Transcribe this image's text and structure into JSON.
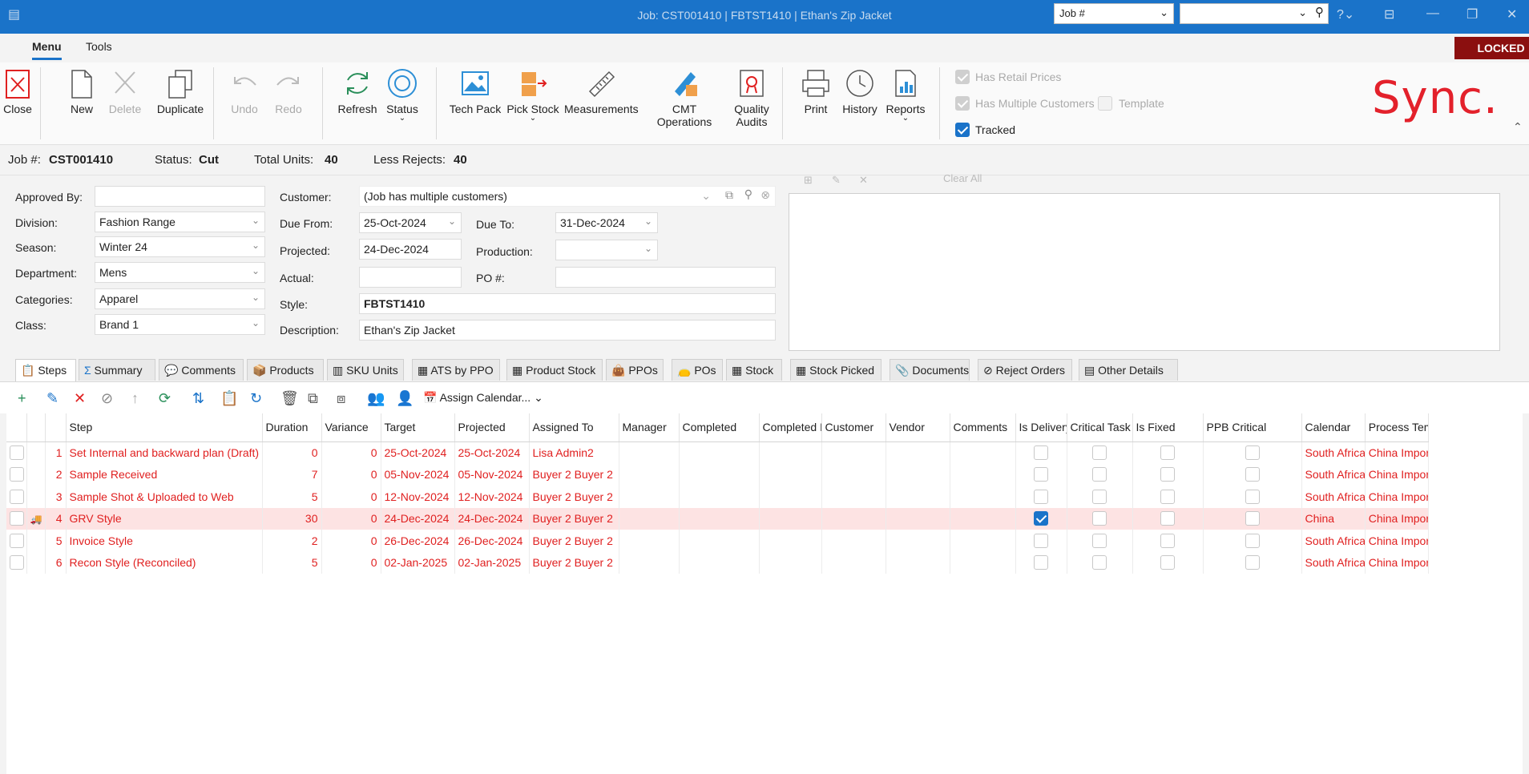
{
  "window": {
    "title": "Job: CST001410 | FBTST1410 | Ethan's Zip Jacket",
    "search_field_label": "Job #",
    "search_value": ""
  },
  "menu": {
    "tabs": [
      "Menu",
      "Tools"
    ],
    "locked_label": "LOCKED"
  },
  "ribbon": {
    "buttons": {
      "close": "Close",
      "new": "New",
      "delete": "Delete",
      "duplicate": "Duplicate",
      "undo": "Undo",
      "redo": "Redo",
      "refresh": "Refresh",
      "status": "Status",
      "tech_pack": "Tech Pack",
      "pick_stock": "Pick Stock",
      "measurements": "Measurements",
      "cmt_operations": "CMT Operations",
      "quality_audits_1": "Quality",
      "quality_audits_2": "Audits",
      "print": "Print",
      "history": "History",
      "reports": "Reports"
    },
    "checks": {
      "retail_prices": "Has Retail Prices",
      "multiple_customers": "Has Multiple Customers",
      "template": "Template",
      "tracked": "Tracked"
    },
    "logo": "Sync."
  },
  "info": {
    "job_label": "Job #:",
    "job_value": "CST001410",
    "status_label": "Status:",
    "status_value": "Cut",
    "units_label": "Total Units:",
    "units_value": "40",
    "rejects_label": "Less Rejects:",
    "rejects_value": "40"
  },
  "form": {
    "approved_by_label": "Approved By:",
    "approved_by": "",
    "division_label": "Division:",
    "division": "Fashion Range",
    "season_label": "Season:",
    "season": "Winter 24",
    "department_label": "Department:",
    "department": "Mens",
    "categories_label": "Categories:",
    "categories": "Apparel",
    "class_label": "Class:",
    "class": "Brand 1",
    "customer_label": "Customer:",
    "customer": "(Job has multiple customers)",
    "due_from_label": "Due From:",
    "due_from": "25-Oct-2024",
    "due_to_label": "Due To:",
    "due_to": "31-Dec-2024",
    "projected_label": "Projected:",
    "projected": "24-Dec-2024",
    "production_label": "Production:",
    "production": "",
    "actual_label": "Actual:",
    "actual": "",
    "po_label": "PO #:",
    "po": "",
    "style_label": "Style:",
    "style": "FBTST1410",
    "description_label": "Description:",
    "description": "Ethan's Zip Jacket",
    "clear_all": "Clear All"
  },
  "tabs": [
    "Steps",
    "Summary",
    "Comments",
    "Products",
    "SKU Units",
    "ATS by PPO",
    "Product Stock",
    "PPOs",
    "POs",
    "Stock",
    "Stock Picked",
    "Documents",
    "Reject Orders",
    "Other Details"
  ],
  "grid_toolbar": {
    "assign_calendar": "Assign Calendar..."
  },
  "grid": {
    "columns": [
      "Step",
      "Duration",
      "Variance",
      "Target",
      "Projected",
      "Assigned To",
      "Manager",
      "Completed",
      "Completed By",
      "Customer",
      "Vendor",
      "Comments",
      "Is Delivery",
      "Critical Task",
      "Is Fixed",
      "PPB Critical",
      "Calendar",
      "Process Template"
    ],
    "rows": [
      {
        "no": "1",
        "step": "Set Internal and backward plan (Draft)",
        "duration": "0",
        "variance": "0",
        "target": "25-Oct-2024",
        "projected": "25-Oct-2024",
        "assigned": "Lisa Admin2",
        "delivery": false,
        "calendar": "South Africa",
        "template": "China Import",
        "selected": false
      },
      {
        "no": "2",
        "step": "Sample Received",
        "duration": "7",
        "variance": "0",
        "target": "05-Nov-2024",
        "projected": "05-Nov-2024",
        "assigned": "Buyer 2 Buyer 2",
        "delivery": false,
        "calendar": "South Africa",
        "template": "China Import",
        "selected": false
      },
      {
        "no": "3",
        "step": "Sample Shot & Uploaded to Web",
        "duration": "5",
        "variance": "0",
        "target": "12-Nov-2024",
        "projected": "12-Nov-2024",
        "assigned": "Buyer 2 Buyer 2",
        "delivery": false,
        "calendar": "South Africa",
        "template": "China Import",
        "selected": false
      },
      {
        "no": "4",
        "step": "GRV Style",
        "duration": "30",
        "variance": "0",
        "target": "24-Dec-2024",
        "projected": "24-Dec-2024",
        "assigned": "Buyer 2 Buyer 2",
        "delivery": true,
        "calendar": "China",
        "template": "China Import",
        "selected": true
      },
      {
        "no": "5",
        "step": "Invoice Style",
        "duration": "2",
        "variance": "0",
        "target": "26-Dec-2024",
        "projected": "26-Dec-2024",
        "assigned": "Buyer 2 Buyer 2",
        "delivery": false,
        "calendar": "South Africa",
        "template": "China Import",
        "selected": false
      },
      {
        "no": "6",
        "step": "Recon Style (Reconciled)",
        "duration": "5",
        "variance": "0",
        "target": "02-Jan-2025",
        "projected": "02-Jan-2025",
        "assigned": "Buyer 2 Buyer 2",
        "delivery": false,
        "calendar": "South Africa",
        "template": "China Import",
        "selected": false
      }
    ]
  },
  "colors": {
    "accent": "#1a73c9",
    "locked": "#8b0f0f",
    "logo": "#e3212b",
    "row_text": "#e02020"
  }
}
